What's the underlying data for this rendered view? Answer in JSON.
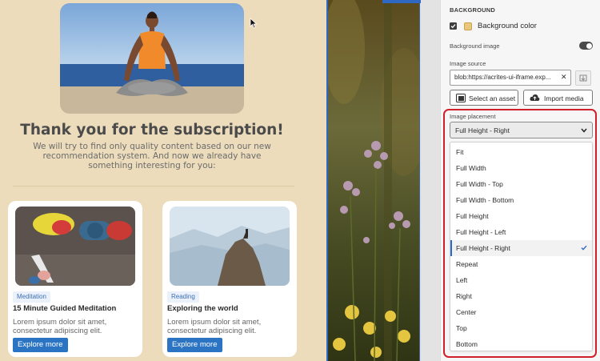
{
  "preview": {
    "title": "Thank you for the subscription!",
    "subtitle": "We will try to find only quality content based on our new recommendation system. And now we already have something interesting for you:",
    "cards": [
      {
        "tag": "Meditation",
        "title": "15 Minute Guided Meditation",
        "description": "Lorem ipsum dolor sit amet, consectetur adipiscing elit.",
        "button": "Explore more"
      },
      {
        "tag": "Reading",
        "title": "Exploring the world",
        "description": "Lorem ipsum dolor sit amet, consectetur adipiscing elit.",
        "button": "Explore more"
      }
    ]
  },
  "panel": {
    "heading": "BACKGROUND",
    "background_color": {
      "label": "Background color",
      "checked": true,
      "swatch_color": "#e9c87d"
    },
    "background_image": {
      "label": "Background image",
      "enabled": true
    },
    "image_source": {
      "label": "Image source",
      "value": "blob:https://acrites-ui-iframe.exp..."
    },
    "buttons": {
      "select_asset": "Select an asset",
      "import_media": "Import media"
    },
    "image_placement": {
      "label": "Image placement",
      "selected": "Full Height - Right",
      "options": [
        "Fit",
        "Full Width",
        "Full Width - Top",
        "Full Width - Bottom",
        "Full Height",
        "Full Height - Left",
        "Full Height - Right",
        "Repeat",
        "Left",
        "Right",
        "Center",
        "Top",
        "Bottom"
      ]
    }
  },
  "colors": {
    "accent_blue": "#2b74c4",
    "highlight_red": "#d0202a",
    "preview_bg": "#ecdcbc"
  },
  "icons": {
    "cursor": "cursor-arrow-icon",
    "checkbox": "checkmark-icon",
    "clear": "close-icon",
    "browse": "folder-browse-icon",
    "select_asset": "image-asset-icon",
    "import_media": "cloud-upload-icon",
    "chevron": "chevron-down-icon",
    "selected_option": "checkmark-icon"
  }
}
